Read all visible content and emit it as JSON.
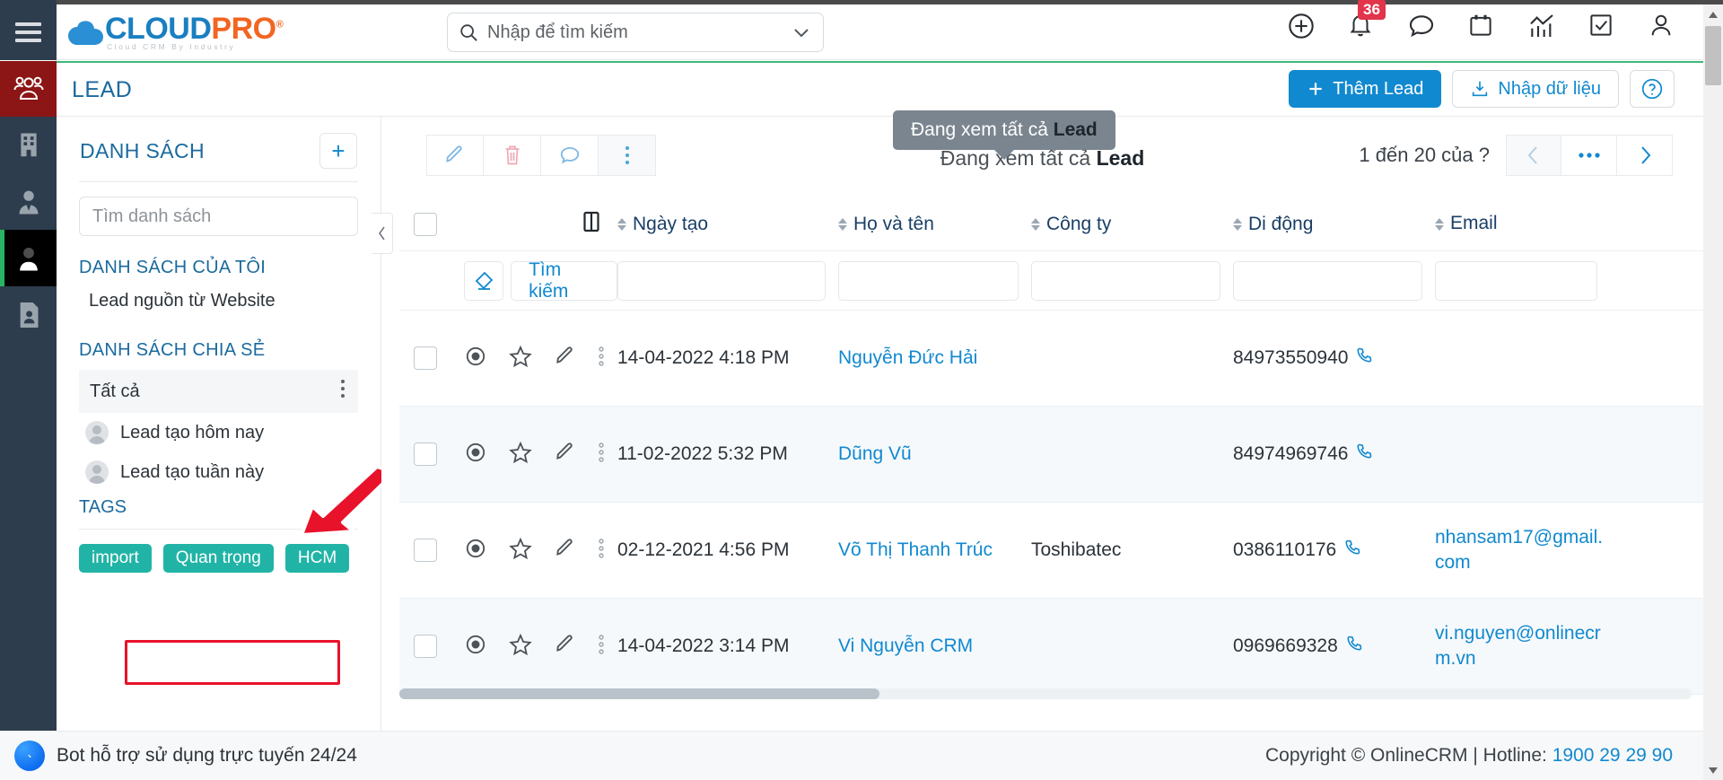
{
  "header": {
    "logo": {
      "part1": "CLOUD",
      "part2": "PRO",
      "registered": "®",
      "tagline": "Cloud CRM By Industry"
    },
    "search": {
      "placeholder": "Nhập để tìm kiếm",
      "value": ""
    },
    "icons": [
      {
        "name": "add-circle-icon"
      },
      {
        "name": "bell-icon",
        "badge": "36"
      },
      {
        "name": "chat-icon"
      },
      {
        "name": "calendar-icon"
      },
      {
        "name": "analytics-icon"
      },
      {
        "name": "checkbox-icon"
      },
      {
        "name": "user-icon"
      }
    ]
  },
  "pagebar": {
    "title": "LEAD",
    "add_lead": "Thêm Lead",
    "import": "Nhập dữ liệu",
    "help": "?"
  },
  "sidebar_rail": [
    {
      "name": "leads-icon",
      "active": true
    },
    {
      "name": "company-icon",
      "active": false
    },
    {
      "name": "contact-person-icon",
      "active": false
    },
    {
      "name": "person-icon",
      "active": true
    },
    {
      "name": "document-person-icon",
      "active": false
    }
  ],
  "listpanel": {
    "title": "DANH SÁCH",
    "add_label": "+",
    "search_placeholder": "Tìm danh sách",
    "my_lists_title": "DANH SÁCH CỦA TÔI",
    "my_lists": [
      "Lead nguồn từ Website"
    ],
    "shared_title": "DANH SÁCH CHIA SẺ",
    "all_label": "Tất cả",
    "shared_items": [
      {
        "label": "Lead tạo hôm nay",
        "highlighted": false
      },
      {
        "label": "Lead tạo tuần này",
        "highlighted": true
      }
    ],
    "tags_title": "TAGS",
    "tags": [
      "import",
      "Quan trọng",
      "HCM"
    ]
  },
  "main": {
    "toolbar": [
      {
        "name": "edit-icon"
      },
      {
        "name": "delete-icon"
      },
      {
        "name": "comment-icon"
      },
      {
        "name": "more-vertical-icon"
      }
    ],
    "view_info_prefix": "Đang xem tất cả ",
    "view_info_strong": "Lead",
    "tooltip_prefix": "Đang xem tất cả ",
    "tooltip_strong": "Lead",
    "pager": {
      "label": "1 đến 20 của  ?",
      "prev": "‹",
      "more": "•••",
      "next": "›"
    },
    "filter": {
      "clear_name": "eraser-icon",
      "search_label": "Tìm kiếm",
      "values": [
        "",
        "",
        "",
        "",
        ""
      ]
    },
    "columns": [
      {
        "key": "date",
        "label": "Ngày tạo"
      },
      {
        "key": "name",
        "label": "Họ và tên"
      },
      {
        "key": "company",
        "label": "Công ty"
      },
      {
        "key": "mobile",
        "label": "Di động"
      },
      {
        "key": "email",
        "label": "Email"
      }
    ],
    "rows": [
      {
        "date": "14-04-2022 4:18 PM",
        "name": "Nguyễn Đức Hải",
        "company": "",
        "mobile": "84973550940",
        "email": ""
      },
      {
        "date": "11-02-2022 5:32 PM",
        "name": "Dũng Vũ",
        "company": "",
        "mobile": "84974969746",
        "email": ""
      },
      {
        "date": "02-12-2021 4:56 PM",
        "name": "Võ Thị Thanh Trúc",
        "company": "Toshibatec",
        "mobile": "0386110176",
        "email": "nhansam17@gmail.com"
      },
      {
        "date": "14-04-2022 3:14 PM",
        "name": "Vi Nguyễn CRM",
        "company": "",
        "mobile": "0969669328",
        "email": "vi.nguyen@onlinecrm.vn"
      }
    ]
  },
  "footer": {
    "bot_label": "Bot hỗ trợ sử dụng trực tuyến 24/24",
    "copyright": "Copyright © OnlineCRM | Hotline: ",
    "hotline": "1900 29 29 90"
  },
  "colors": {
    "brand_blue": "#1189d0",
    "brand_orange": "#f26522",
    "accent_green": "#3cb878",
    "module_red": "#8c1515",
    "tag_teal": "#21b4a6",
    "badge_red": "#e2344a",
    "annotation_red": "#e8122a",
    "sidebar_dark": "#2e3d4d"
  }
}
